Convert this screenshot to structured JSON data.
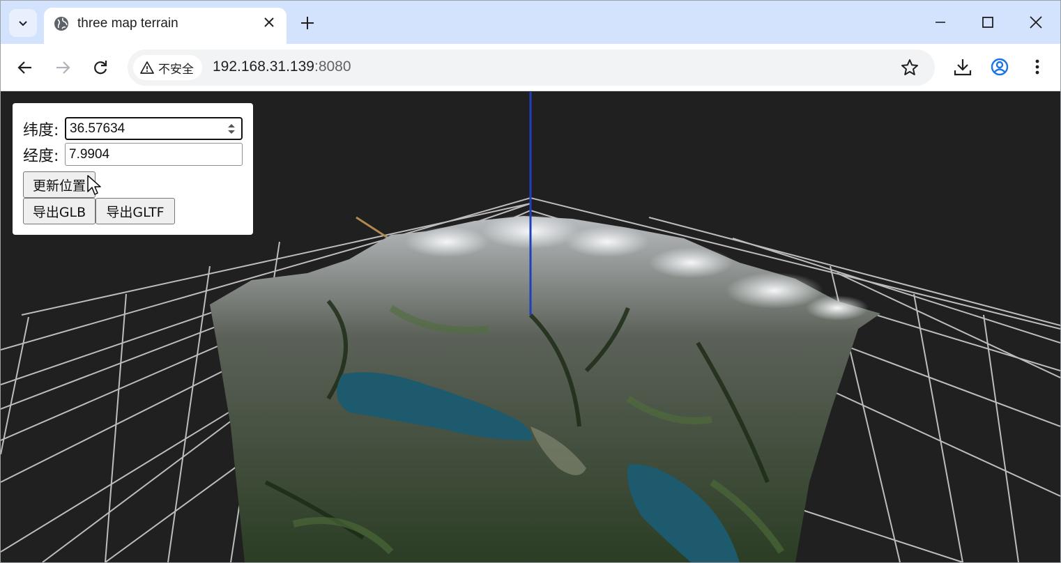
{
  "browser": {
    "tab_title": "three map terrain",
    "security_label": "不安全",
    "url_host": "192.168.31.139",
    "url_port": ":8080"
  },
  "icons": {
    "tab_search": "chevron-down-icon",
    "favicon": "globe-icon",
    "tab_close": "close-icon",
    "new_tab": "plus-icon",
    "minimize": "minimize-icon",
    "maximize": "maximize-icon",
    "close_window": "close-icon",
    "back": "arrow-left-icon",
    "forward": "arrow-right-icon",
    "reload": "reload-icon",
    "warning": "warning-icon",
    "bookmark": "star-icon",
    "download": "download-icon",
    "profile": "profile-icon",
    "menu": "more-vert-icon"
  },
  "panel": {
    "lat_label": "纬度:",
    "lat_value": "36.57634",
    "lon_label": "经度:",
    "lon_value": "7.9904",
    "update_button": "更新位置",
    "export_glb": "导出GLB",
    "export_gltf": "导出GLTF"
  },
  "colors": {
    "background": "#202020",
    "grid": "#bfbfbf",
    "y_axis": "#1f3fbf",
    "x_axis": "#b08a50",
    "water": "#1e5a6e"
  }
}
